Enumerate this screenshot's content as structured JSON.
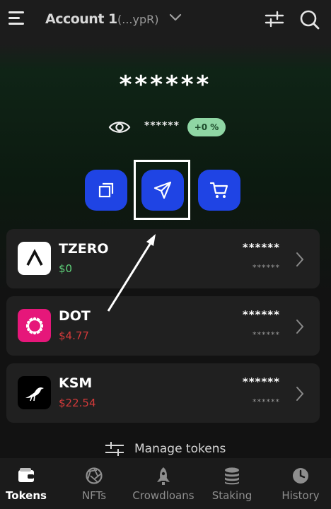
{
  "header": {
    "account_name": "Account 1",
    "account_address": "(...ypR)",
    "icons": [
      "menu-icon",
      "chevron-down-icon",
      "sliders-icon",
      "search-icon"
    ]
  },
  "portfolio": {
    "balance": "******",
    "sub_balance": "******",
    "change": "+0 %",
    "change_color": "#8fd6a4"
  },
  "actions": [
    {
      "name": "copy-address",
      "icon": "copy-icon"
    },
    {
      "name": "send",
      "icon": "send-icon"
    },
    {
      "name": "buy",
      "icon": "cart-icon"
    }
  ],
  "accent_color": "#1f44e4",
  "tokens": [
    {
      "symbol": "TZERO",
      "price": "$0",
      "price_color": "#5fd37a",
      "balance": "******",
      "fiat": "******"
    },
    {
      "symbol": "DOT",
      "price": "$4.77",
      "price_color": "#d23a3a",
      "balance": "******",
      "fiat": "******"
    },
    {
      "symbol": "KSM",
      "price": "$22.54",
      "price_color": "#d23a3a",
      "balance": "******",
      "fiat": "******"
    }
  ],
  "manage_tokens": "Manage tokens",
  "nav": [
    {
      "label": "Tokens",
      "icon": "wallet-icon",
      "active": true
    },
    {
      "label": "NFTs",
      "icon": "aperture-icon",
      "active": false
    },
    {
      "label": "Crowdloans",
      "icon": "rocket-icon",
      "active": false
    },
    {
      "label": "Staking",
      "icon": "coins-stack-icon",
      "active": false
    },
    {
      "label": "History",
      "icon": "clock-icon",
      "active": false
    }
  ]
}
